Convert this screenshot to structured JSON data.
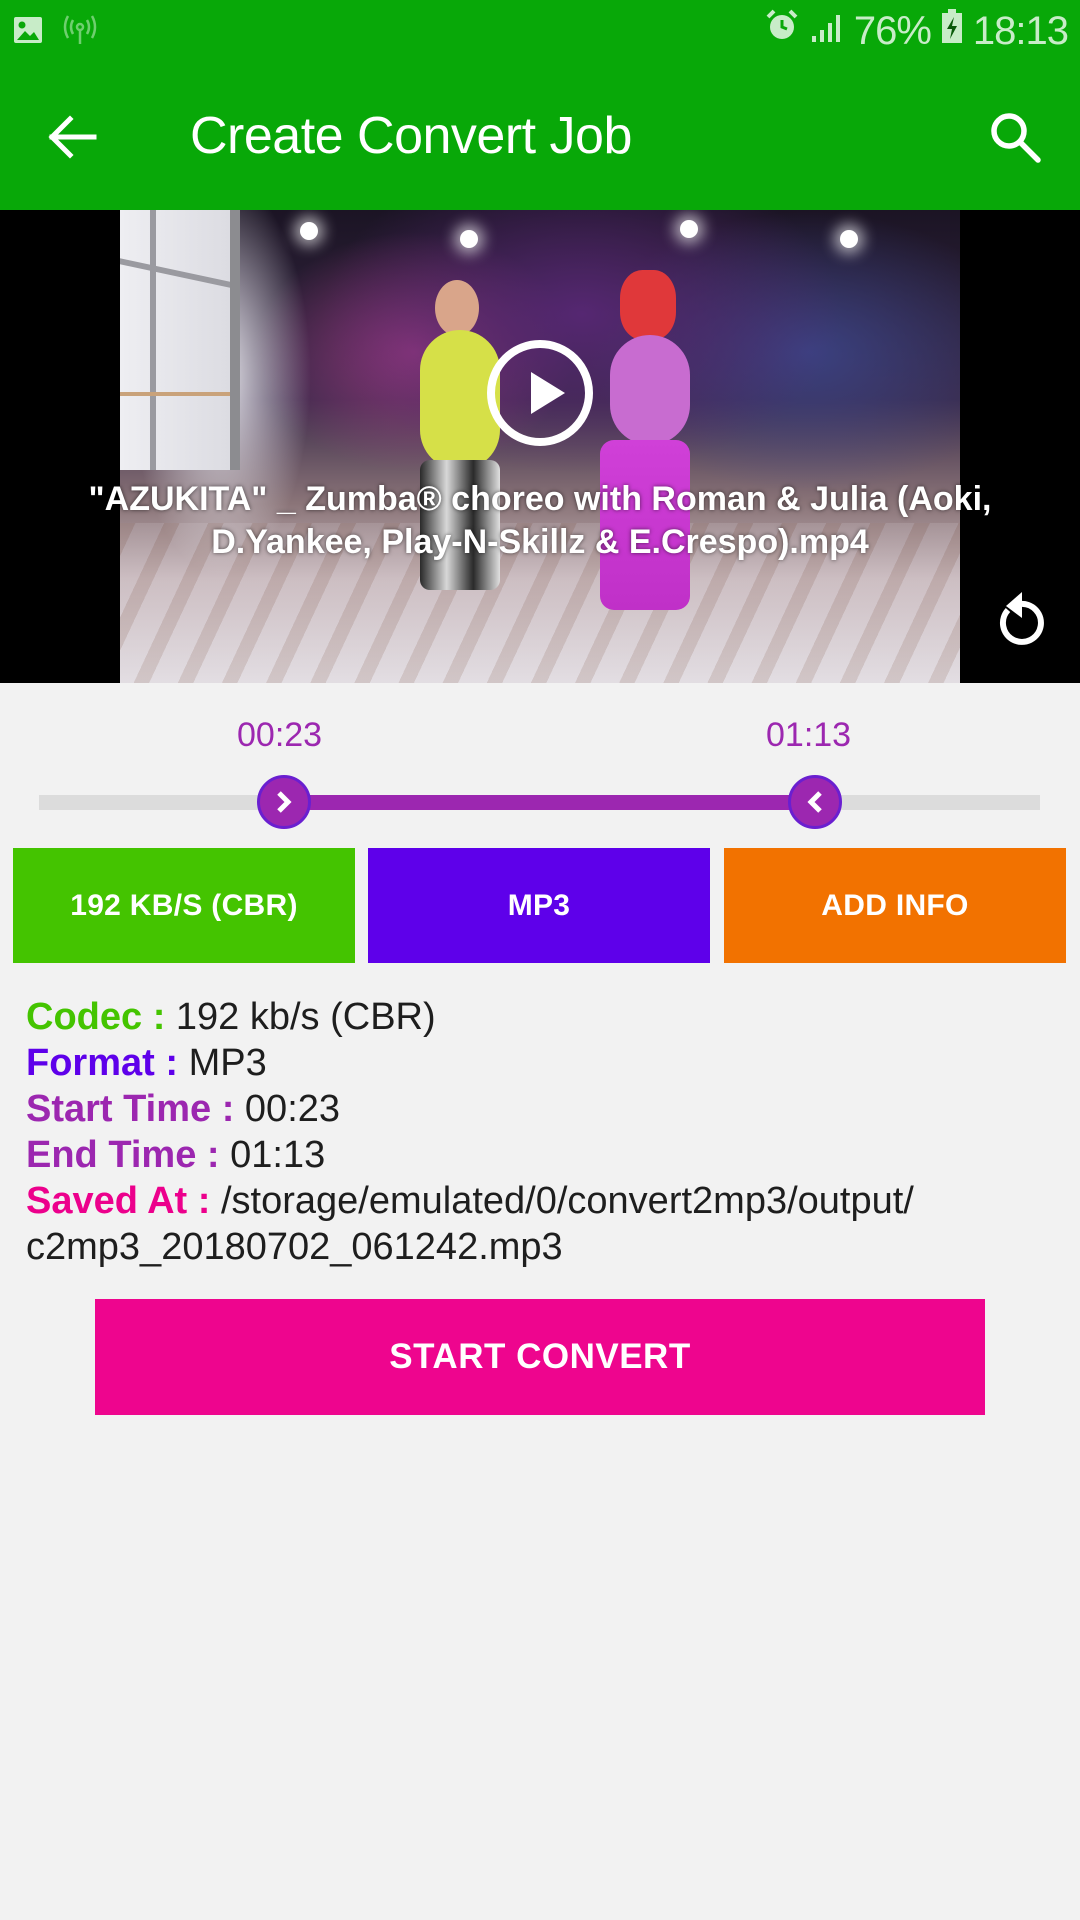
{
  "status_bar": {
    "left_icons": [
      "image-notification-icon",
      "hotspot-icon"
    ],
    "right_icons": [
      "alarm-icon",
      "signal-icon",
      "battery-charging-icon"
    ],
    "battery": "76%",
    "time": "18:13"
  },
  "app_bar": {
    "title": "Create Convert Job",
    "back_icon": "arrow-back-icon",
    "search_icon": "search-icon"
  },
  "video": {
    "title": "\"AZUKITA\" _ Zumba® choreo with Roman & Julia (Aoki, D.Yankee, Play-N-Skillz & E.Crespo).mp4",
    "play_icon": "play-circle-icon",
    "replay_icon": "replay-icon"
  },
  "trim": {
    "start_label": "00:23",
    "end_label": "01:13",
    "start_fraction": 0.245,
    "end_fraction": 0.775
  },
  "options": {
    "codec_label": "192 KB/S (CBR)",
    "format_label": "MP3",
    "info_label": "ADD INFO"
  },
  "colors": {
    "primary_green": "#08a808",
    "codec_green": "#44c400",
    "format_violet": "#5e00ea",
    "info_orange": "#f27200",
    "trim_purple": "#9c27b0",
    "action_pink": "#ee058e"
  },
  "details": {
    "codec": {
      "label": "Codec : ",
      "value": "192 kb/s (CBR)"
    },
    "format": {
      "label": "Format : ",
      "value": "MP3"
    },
    "start_time": {
      "label": "Start Time : ",
      "value": "00:23"
    },
    "end_time": {
      "label": "End Time : ",
      "value": "01:13"
    },
    "saved_at": {
      "label": "Saved At : ",
      "value": "/storage/emulated/0/convert2mp3/output/ c2mp3_20180702_061242.mp3"
    }
  },
  "actions": {
    "start_convert": "START CONVERT"
  }
}
